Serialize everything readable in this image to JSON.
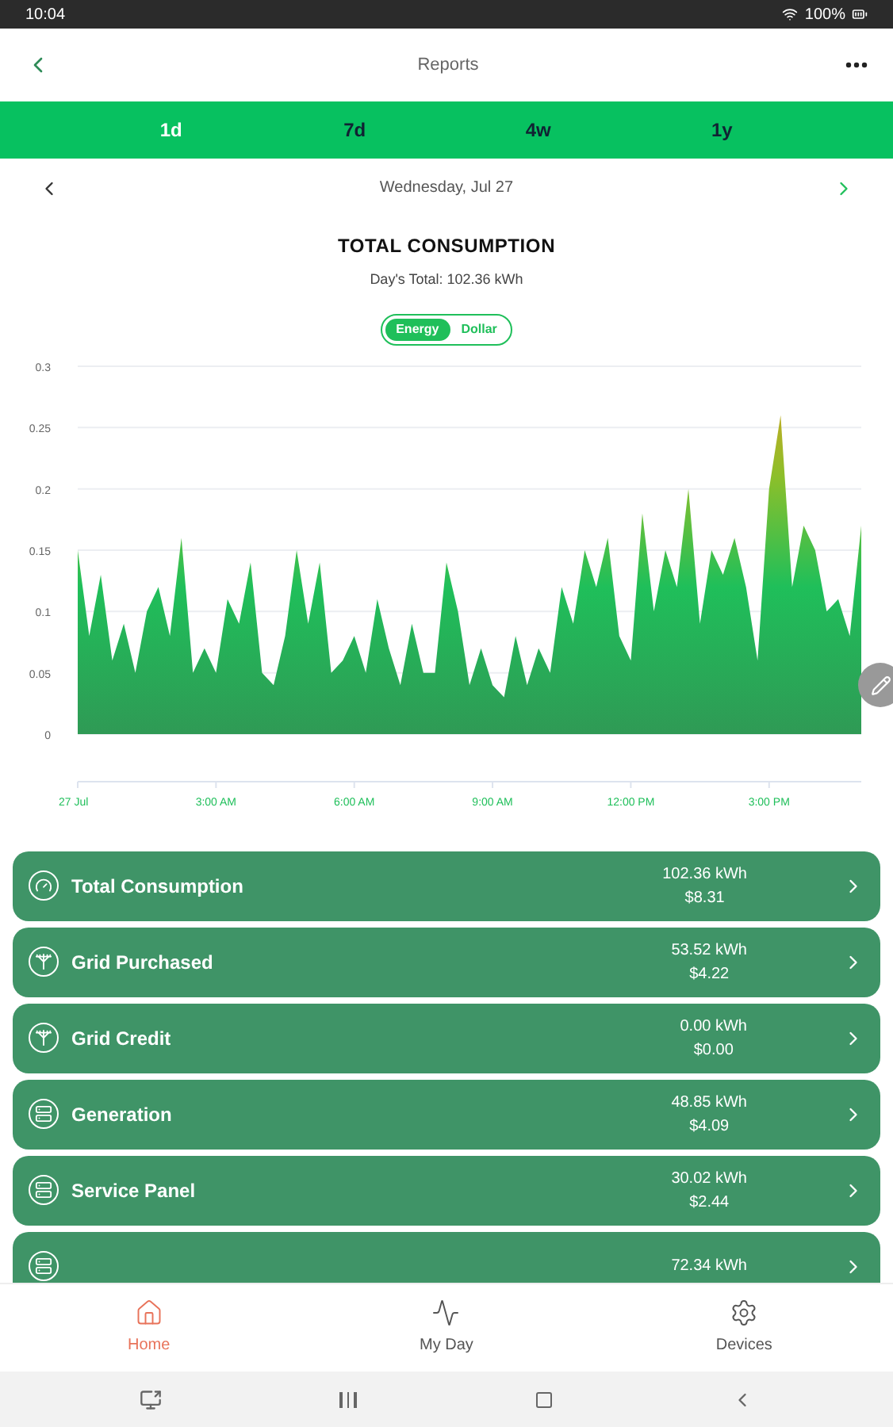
{
  "status_bar": {
    "time": "10:04",
    "battery": "100%"
  },
  "header": {
    "title": "Reports"
  },
  "tabs": [
    {
      "label": "1d",
      "selected": true
    },
    {
      "label": "7d",
      "selected": false
    },
    {
      "label": "4w",
      "selected": false
    },
    {
      "label": "1y",
      "selected": false
    }
  ],
  "date_nav": {
    "date": "Wednesday, Jul 27"
  },
  "summary": {
    "title": "TOTAL CONSUMPTION",
    "subtitle": "Day's Total: 102.36 kWh"
  },
  "unit_toggle": [
    {
      "label": "Energy",
      "selected": true
    },
    {
      "label": "Dollar",
      "selected": false
    }
  ],
  "chart_data": {
    "type": "area",
    "grid": true,
    "xlim": [
      0,
      17
    ],
    "ylim": [
      0,
      0.3
    ],
    "yticks": [
      {
        "value": 0,
        "label": "0"
      },
      {
        "value": 0.05,
        "label": "0.05"
      },
      {
        "value": 0.1,
        "label": "0.1"
      },
      {
        "value": 0.15,
        "label": "0.15"
      },
      {
        "value": 0.2,
        "label": "0.2"
      },
      {
        "value": 0.25,
        "label": "0.25"
      },
      {
        "value": 0.3,
        "label": "0.3"
      }
    ],
    "xticks": [
      {
        "value": 0,
        "label": "27 Jul"
      },
      {
        "value": 3,
        "label": "3:00 AM"
      },
      {
        "value": 6,
        "label": "6:00 AM"
      },
      {
        "value": 9,
        "label": "9:00 AM"
      },
      {
        "value": 12,
        "label": "12:00 PM"
      },
      {
        "value": 15,
        "label": "3:00 PM"
      }
    ],
    "x": [
      0,
      0.25,
      0.5,
      0.75,
      1,
      1.25,
      1.5,
      1.75,
      2,
      2.25,
      2.5,
      2.75,
      3,
      3.25,
      3.5,
      3.75,
      4,
      4.25,
      4.5,
      4.75,
      5,
      5.25,
      5.5,
      5.75,
      6,
      6.25,
      6.5,
      6.75,
      7,
      7.25,
      7.5,
      7.75,
      8,
      8.25,
      8.5,
      8.75,
      9,
      9.25,
      9.5,
      9.75,
      10,
      10.25,
      10.5,
      10.75,
      11,
      11.25,
      11.5,
      11.75,
      12,
      12.25,
      12.5,
      12.75,
      13,
      13.25,
      13.5,
      13.75,
      14,
      14.25,
      14.5,
      14.75,
      15,
      15.25,
      15.5,
      15.75,
      16,
      16.25,
      16.5,
      16.75,
      17
    ],
    "series": [
      {
        "color": "#1fbf5a",
        "values": [
          0.15,
          0.08,
          0.13,
          0.06,
          0.09,
          0.05,
          0.1,
          0.12,
          0.08,
          0.16,
          0.05,
          0.07,
          0.05,
          0.11,
          0.09,
          0.14,
          0.05,
          0.04,
          0.08,
          0.15,
          0.09,
          0.14,
          0.05,
          0.06,
          0.08,
          0.05,
          0.11,
          0.07,
          0.04,
          0.09,
          0.05,
          0.05,
          0.14,
          0.1,
          0.04,
          0.07,
          0.04,
          0.03,
          0.08,
          0.04,
          0.07,
          0.05,
          0.12,
          0.09,
          0.15,
          0.12,
          0.16,
          0.08,
          0.06,
          0.18,
          0.1,
          0.15,
          0.12,
          0.2,
          0.09,
          0.15,
          0.13,
          0.16,
          0.12,
          0.06,
          0.2,
          0.26,
          0.12,
          0.17,
          0.15,
          0.1,
          0.11,
          0.08,
          0.17
        ]
      }
    ]
  },
  "categories": [
    {
      "kind": "meter",
      "label": "Total Consumption",
      "energy": "102.36 kWh",
      "cost": "$8.31"
    },
    {
      "kind": "grid",
      "label": "Grid Purchased",
      "energy": "53.52 kWh",
      "cost": "$4.22"
    },
    {
      "kind": "grid",
      "label": "Grid Credit",
      "energy": "0.00 kWh",
      "cost": "$0.00"
    },
    {
      "kind": "panel",
      "label": "Generation",
      "energy": "48.85 kWh",
      "cost": "$4.09"
    },
    {
      "kind": "panel",
      "label": "Service Panel",
      "energy": "30.02 kWh",
      "cost": "$2.44"
    },
    {
      "kind": "panel",
      "energy": "72.34 kWh"
    }
  ],
  "bottom_nav": [
    {
      "kind": "home",
      "label": "Home",
      "selected": true
    },
    {
      "kind": "day",
      "label": "My Day",
      "selected": false
    },
    {
      "kind": "devices",
      "label": "Devices",
      "selected": false
    }
  ]
}
